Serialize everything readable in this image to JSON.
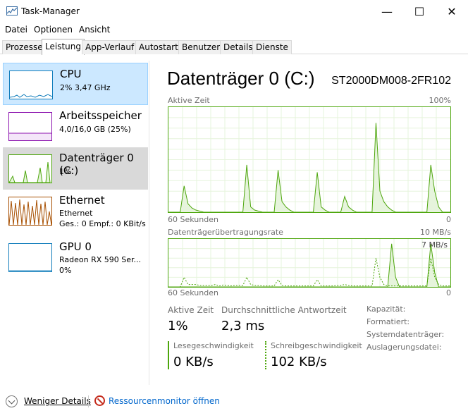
{
  "window": {
    "title": "Task-Manager",
    "minimize": "—",
    "maximize": "☐",
    "close": "✕"
  },
  "menu": [
    "Datei",
    "Optionen",
    "Ansicht"
  ],
  "tabs": [
    "Prozesse",
    "Leistung",
    "App-Verlauf",
    "Autostart",
    "Benutzer",
    "Details",
    "Dienste"
  ],
  "active_tab": "Leistung",
  "sidebar": {
    "items": [
      {
        "title": "CPU",
        "sub1": "2% 3,47 GHz",
        "sub2": "",
        "color": "#117dbb"
      },
      {
        "title": "Arbeitsspeicher",
        "sub1": "4,0/16,0 GB (25%)",
        "sub2": "",
        "color": "#8b12ae"
      },
      {
        "title": "Datenträger 0 (C:)",
        "sub1": "1%",
        "sub2": "",
        "color": "#4da60c"
      },
      {
        "title": "Ethernet",
        "sub1": "Ethernet",
        "sub2": "Ges.: 0 Empf.: 0 KBit/s",
        "color": "#a74f01"
      },
      {
        "title": "GPU 0",
        "sub1": "Radeon RX 590 Ser...",
        "sub2": "0%",
        "color": "#117dbb"
      }
    ]
  },
  "main": {
    "title": "Datenträger 0 (C:)",
    "model": "ST2000DM008-2FR102",
    "graph1": {
      "label": "Aktive Zeit",
      "max": "100%",
      "time": "60 Sekunden",
      "zero": "0"
    },
    "graph2": {
      "label": "Datenträgerübertragungsrate",
      "max": "10 MB/s",
      "inner": "7 MB/s",
      "time": "60 Sekunden",
      "zero": "0"
    },
    "stats": {
      "active_label": "Aktive Zeit",
      "active_value": "1%",
      "resp_label": "Durchschnittliche Antwortzeit",
      "resp_value": "2,3 ms",
      "read_label": "Lesegeschwindigkeit",
      "read_value": "0 KB/s",
      "write_label": "Schreibgeschwindigkeit",
      "write_value": "102 KB/s"
    },
    "props": {
      "labels": [
        "Kapazität:",
        "Formatiert:",
        "Systemdatenträger:",
        "Auslagerungsdatei:"
      ],
      "values": [
        "",
        "",
        "",
        ""
      ]
    }
  },
  "footer": {
    "fewer_details": "Weniger Details",
    "resource_monitor": "Ressourcenmonitor öffnen"
  },
  "colors": {
    "disk": "#4da60c",
    "disk_fill": "#e6f4dc",
    "cpu": "#117dbb",
    "memory": "#8b12ae",
    "ethernet": "#a74f01"
  },
  "chart_data": {
    "type": "area",
    "active_time_percent": [
      0,
      0,
      0,
      0,
      25,
      8,
      4,
      2,
      1,
      0,
      0,
      0,
      0,
      0,
      0,
      0,
      0,
      0,
      0,
      0,
      45,
      5,
      2,
      1,
      0,
      0,
      0,
      0,
      40,
      10,
      5,
      2,
      0,
      0,
      0,
      0,
      0,
      0,
      38,
      5,
      2,
      0,
      0,
      0,
      0,
      15,
      5,
      2,
      0,
      0,
      0,
      0,
      0,
      85,
      20,
      10,
      5,
      2,
      0,
      0,
      0,
      0,
      0,
      0,
      0,
      0,
      0,
      45,
      20,
      5,
      0,
      0,
      0
    ],
    "transfer_rate_series": [
      {
        "name": "read",
        "values": [
          0,
          0,
          0,
          0,
          0,
          0,
          0,
          0,
          0,
          0,
          0,
          0,
          0,
          0,
          0,
          0,
          0,
          0,
          0,
          0,
          0,
          0,
          0,
          0,
          0,
          0,
          0,
          0,
          0,
          0,
          0,
          0,
          0,
          0,
          0,
          0,
          0,
          0,
          0,
          0,
          0,
          0,
          0,
          0,
          0,
          0,
          0,
          0,
          0,
          0,
          0,
          0,
          0,
          0,
          0,
          0,
          0,
          9,
          2,
          0,
          0,
          0,
          0,
          0,
          0,
          0,
          0,
          9,
          3,
          0,
          0,
          0,
          0
        ]
      },
      {
        "name": "write",
        "values": [
          0,
          0,
          0,
          0,
          2,
          0.5,
          0.5,
          0.5,
          0.3,
          0.3,
          0.3,
          0.3,
          0.5,
          0.2,
          0.4,
          0.3,
          0.2,
          0.3,
          0.3,
          0.3,
          2,
          0.5,
          0.3,
          0.3,
          0.2,
          0.2,
          0.2,
          0.2,
          1.5,
          0.3,
          0.2,
          0.2,
          0.2,
          0.2,
          0.2,
          0.2,
          0.2,
          0.2,
          1.5,
          0.2,
          0.2,
          0.2,
          0.2,
          0.3,
          0.3,
          0.5,
          0.3,
          0.2,
          0.2,
          0.2,
          0.2,
          0.2,
          0.2,
          6,
          2,
          0.5,
          0.2,
          0.2,
          0.2,
          0.2,
          0.2,
          0.2,
          0.2,
          0.2,
          0.2,
          0.2,
          0.2,
          6,
          2,
          0.5,
          0.2,
          0.2,
          0.2
        ]
      }
    ]
  }
}
